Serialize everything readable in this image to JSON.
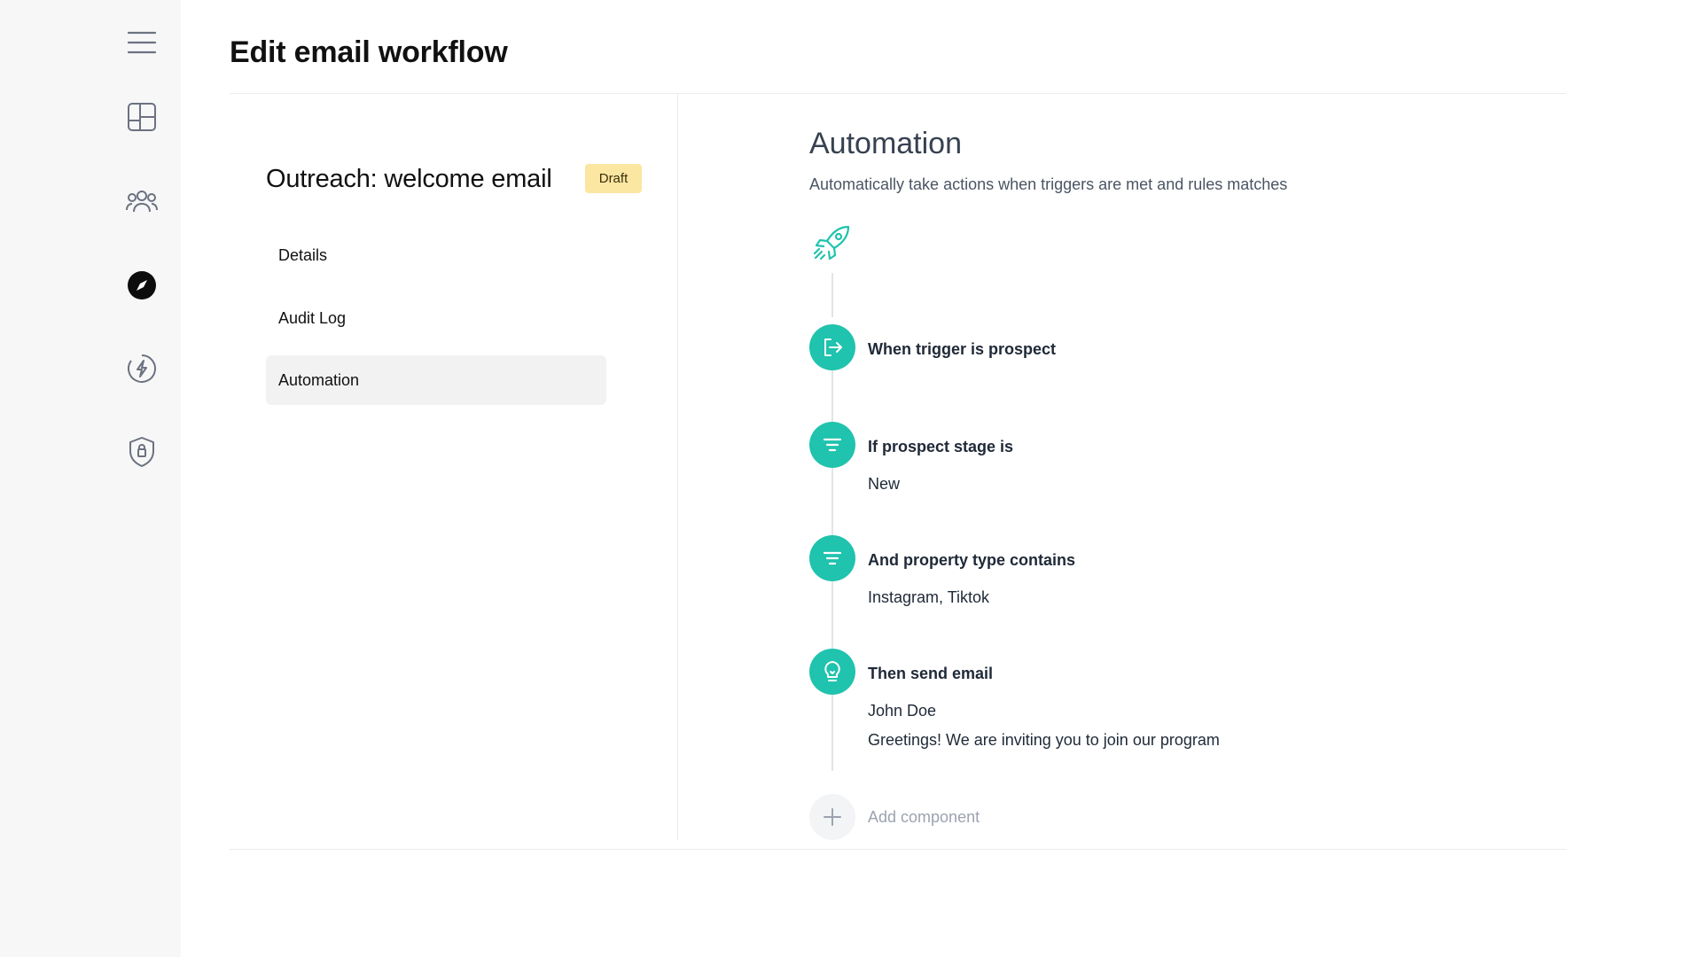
{
  "header": {
    "title": "Edit email workflow"
  },
  "sidebar": {
    "icons": [
      "menu-icon",
      "layout-icon",
      "users-icon",
      "compass-icon",
      "lightning-icon",
      "shield-icon"
    ],
    "active": "compass-icon"
  },
  "workflow": {
    "name": "Outreach: welcome email",
    "status": "Draft",
    "nav": [
      {
        "label": "Details",
        "active": false
      },
      {
        "label": "Audit Log",
        "active": false
      },
      {
        "label": "Automation",
        "active": true
      }
    ]
  },
  "automation": {
    "title": "Automation",
    "subtitle": "Automatically take actions when triggers are met and rules matches",
    "steps": [
      {
        "icon": "exit-icon",
        "title": "When trigger is prospect",
        "lines": []
      },
      {
        "icon": "filter-icon",
        "title": "If prospect stage is",
        "lines": [
          "New"
        ]
      },
      {
        "icon": "filter-icon",
        "title": "And property type contains",
        "lines": [
          "Instagram, Tiktok"
        ]
      },
      {
        "icon": "bulb-icon",
        "title": "Then send email",
        "lines": [
          "John Doe",
          "Greetings! We are inviting you to join our program"
        ]
      }
    ],
    "add_label": "Add component"
  },
  "colors": {
    "accent": "#20c3ad",
    "badge_bg": "#fbe6a2",
    "sidebar_bg": "#f7f7f8"
  }
}
